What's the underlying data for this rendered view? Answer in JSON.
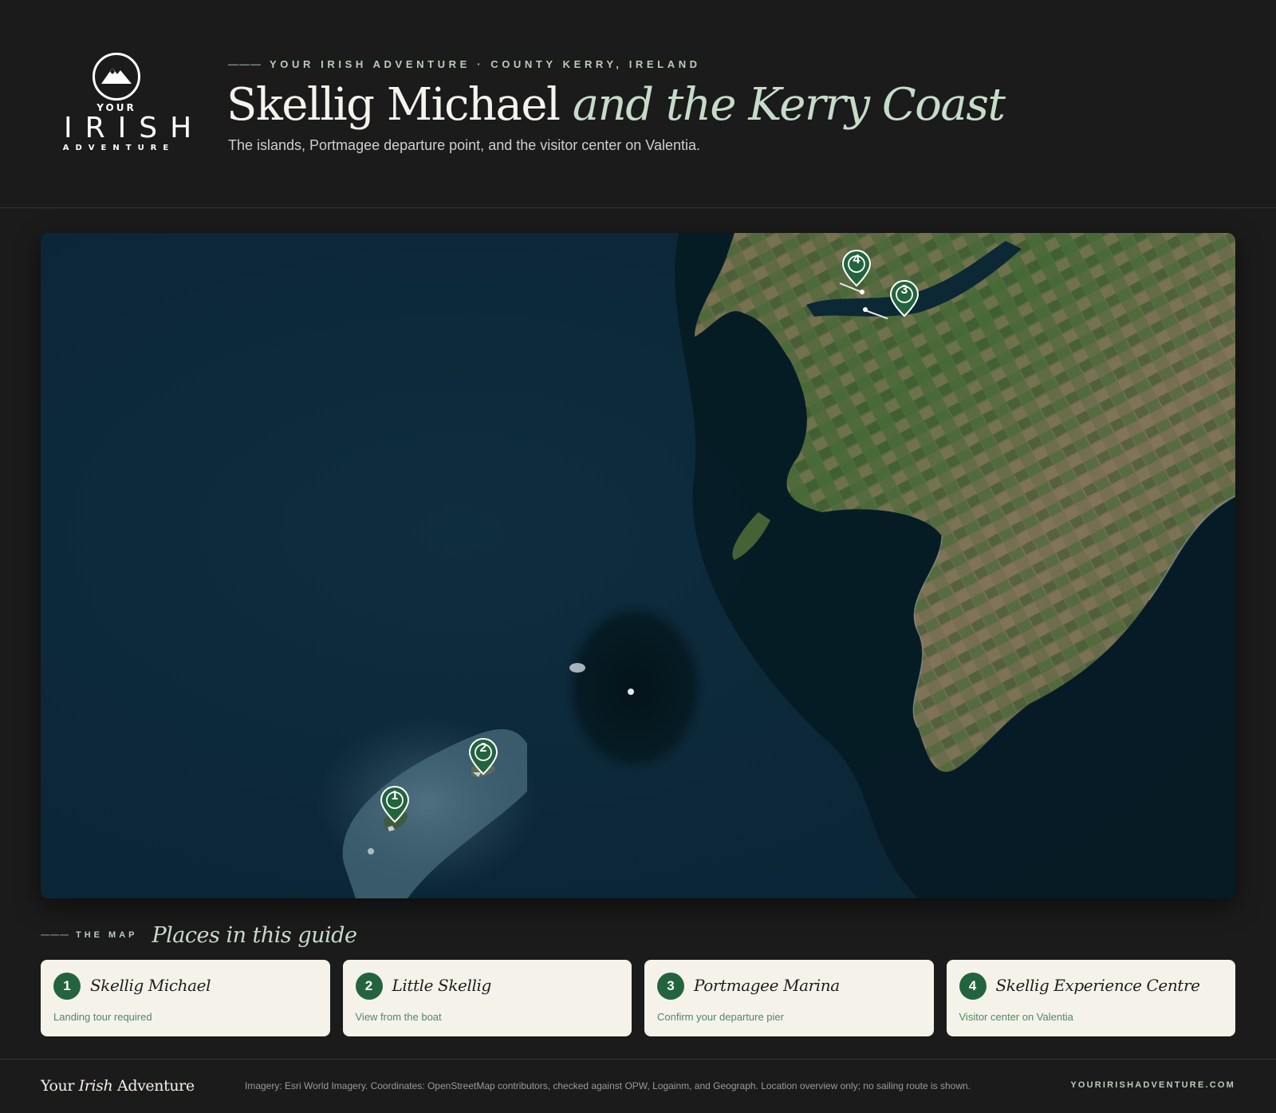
{
  "brand": {
    "logo_your": "YOUR",
    "logo_irish": "IRISH",
    "logo_adventure": "ADVENTURE"
  },
  "header": {
    "kicker": "YOUR IRISH ADVENTURE · COUNTY KERRY, IRELAND",
    "title_main": "Skellig Michael",
    "title_italic": "and the Kerry Coast",
    "subtitle": "The islands, Portmagee departure point, and the visitor center on Valentia."
  },
  "map": {
    "markers": [
      {
        "number": "1",
        "name": "Skellig Michael"
      },
      {
        "number": "2",
        "name": "Little Skellig"
      },
      {
        "number": "3",
        "name": "Portmagee Marina"
      },
      {
        "number": "4",
        "name": "Skellig Experience Centre"
      }
    ],
    "marker_color": "#23643f"
  },
  "places": {
    "kicker": "THE MAP",
    "title": "Places in this guide",
    "items": [
      {
        "number": "1",
        "name": "Skellig Michael",
        "note": "Landing tour required"
      },
      {
        "number": "2",
        "name": "Little Skellig",
        "note": "View from the boat"
      },
      {
        "number": "3",
        "name": "Portmagee Marina",
        "note": "Confirm your departure pier"
      },
      {
        "number": "4",
        "name": "Skellig Experience Centre",
        "note": "Visitor center on Valentia"
      }
    ]
  },
  "footer": {
    "brand_pre": "Your",
    "brand_italic": "Irish",
    "brand_post": "Adventure",
    "credit": "Imagery: Esri World Imagery. Coordinates: OpenStreetMap contributors, checked against OPW, Logainm, and Geograph. Location overview only; no sailing route is shown.",
    "url": "YOURIRISHADVENTURE.COM"
  },
  "colors": {
    "background": "#1b1b1b",
    "accent_green": "#23643f",
    "light_green": "#c6dcc9",
    "card_bg": "#f5f2ea",
    "sea": "#0c2a3a"
  }
}
